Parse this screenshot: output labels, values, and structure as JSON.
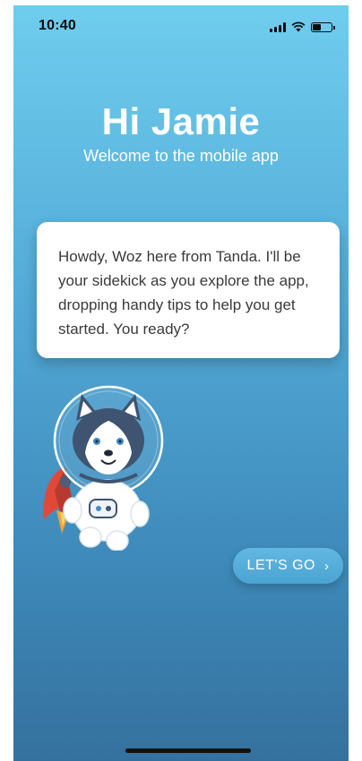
{
  "status_bar": {
    "time": "10:40",
    "signal_icon": "cellular-signal-icon",
    "wifi_icon": "wifi-icon",
    "battery_icon": "battery-icon",
    "battery_level": 0.45
  },
  "header": {
    "greeting": "Hi Jamie",
    "subtitle": "Welcome to the mobile app"
  },
  "tip_card": {
    "text": "Howdy, Woz here from Tanda. I'll be your sidekick as you explore the app, dropping handy tips to help you get started. You ready?"
  },
  "mascot": {
    "icon": "astronaut-husky-mascot"
  },
  "cta": {
    "label": "LET'S GO",
    "icon": "chevron-right-icon"
  },
  "colors": {
    "background_top": "#6fcdee",
    "background_bottom": "#35719e",
    "button": "#4aa3d2",
    "card": "#ffffff"
  }
}
